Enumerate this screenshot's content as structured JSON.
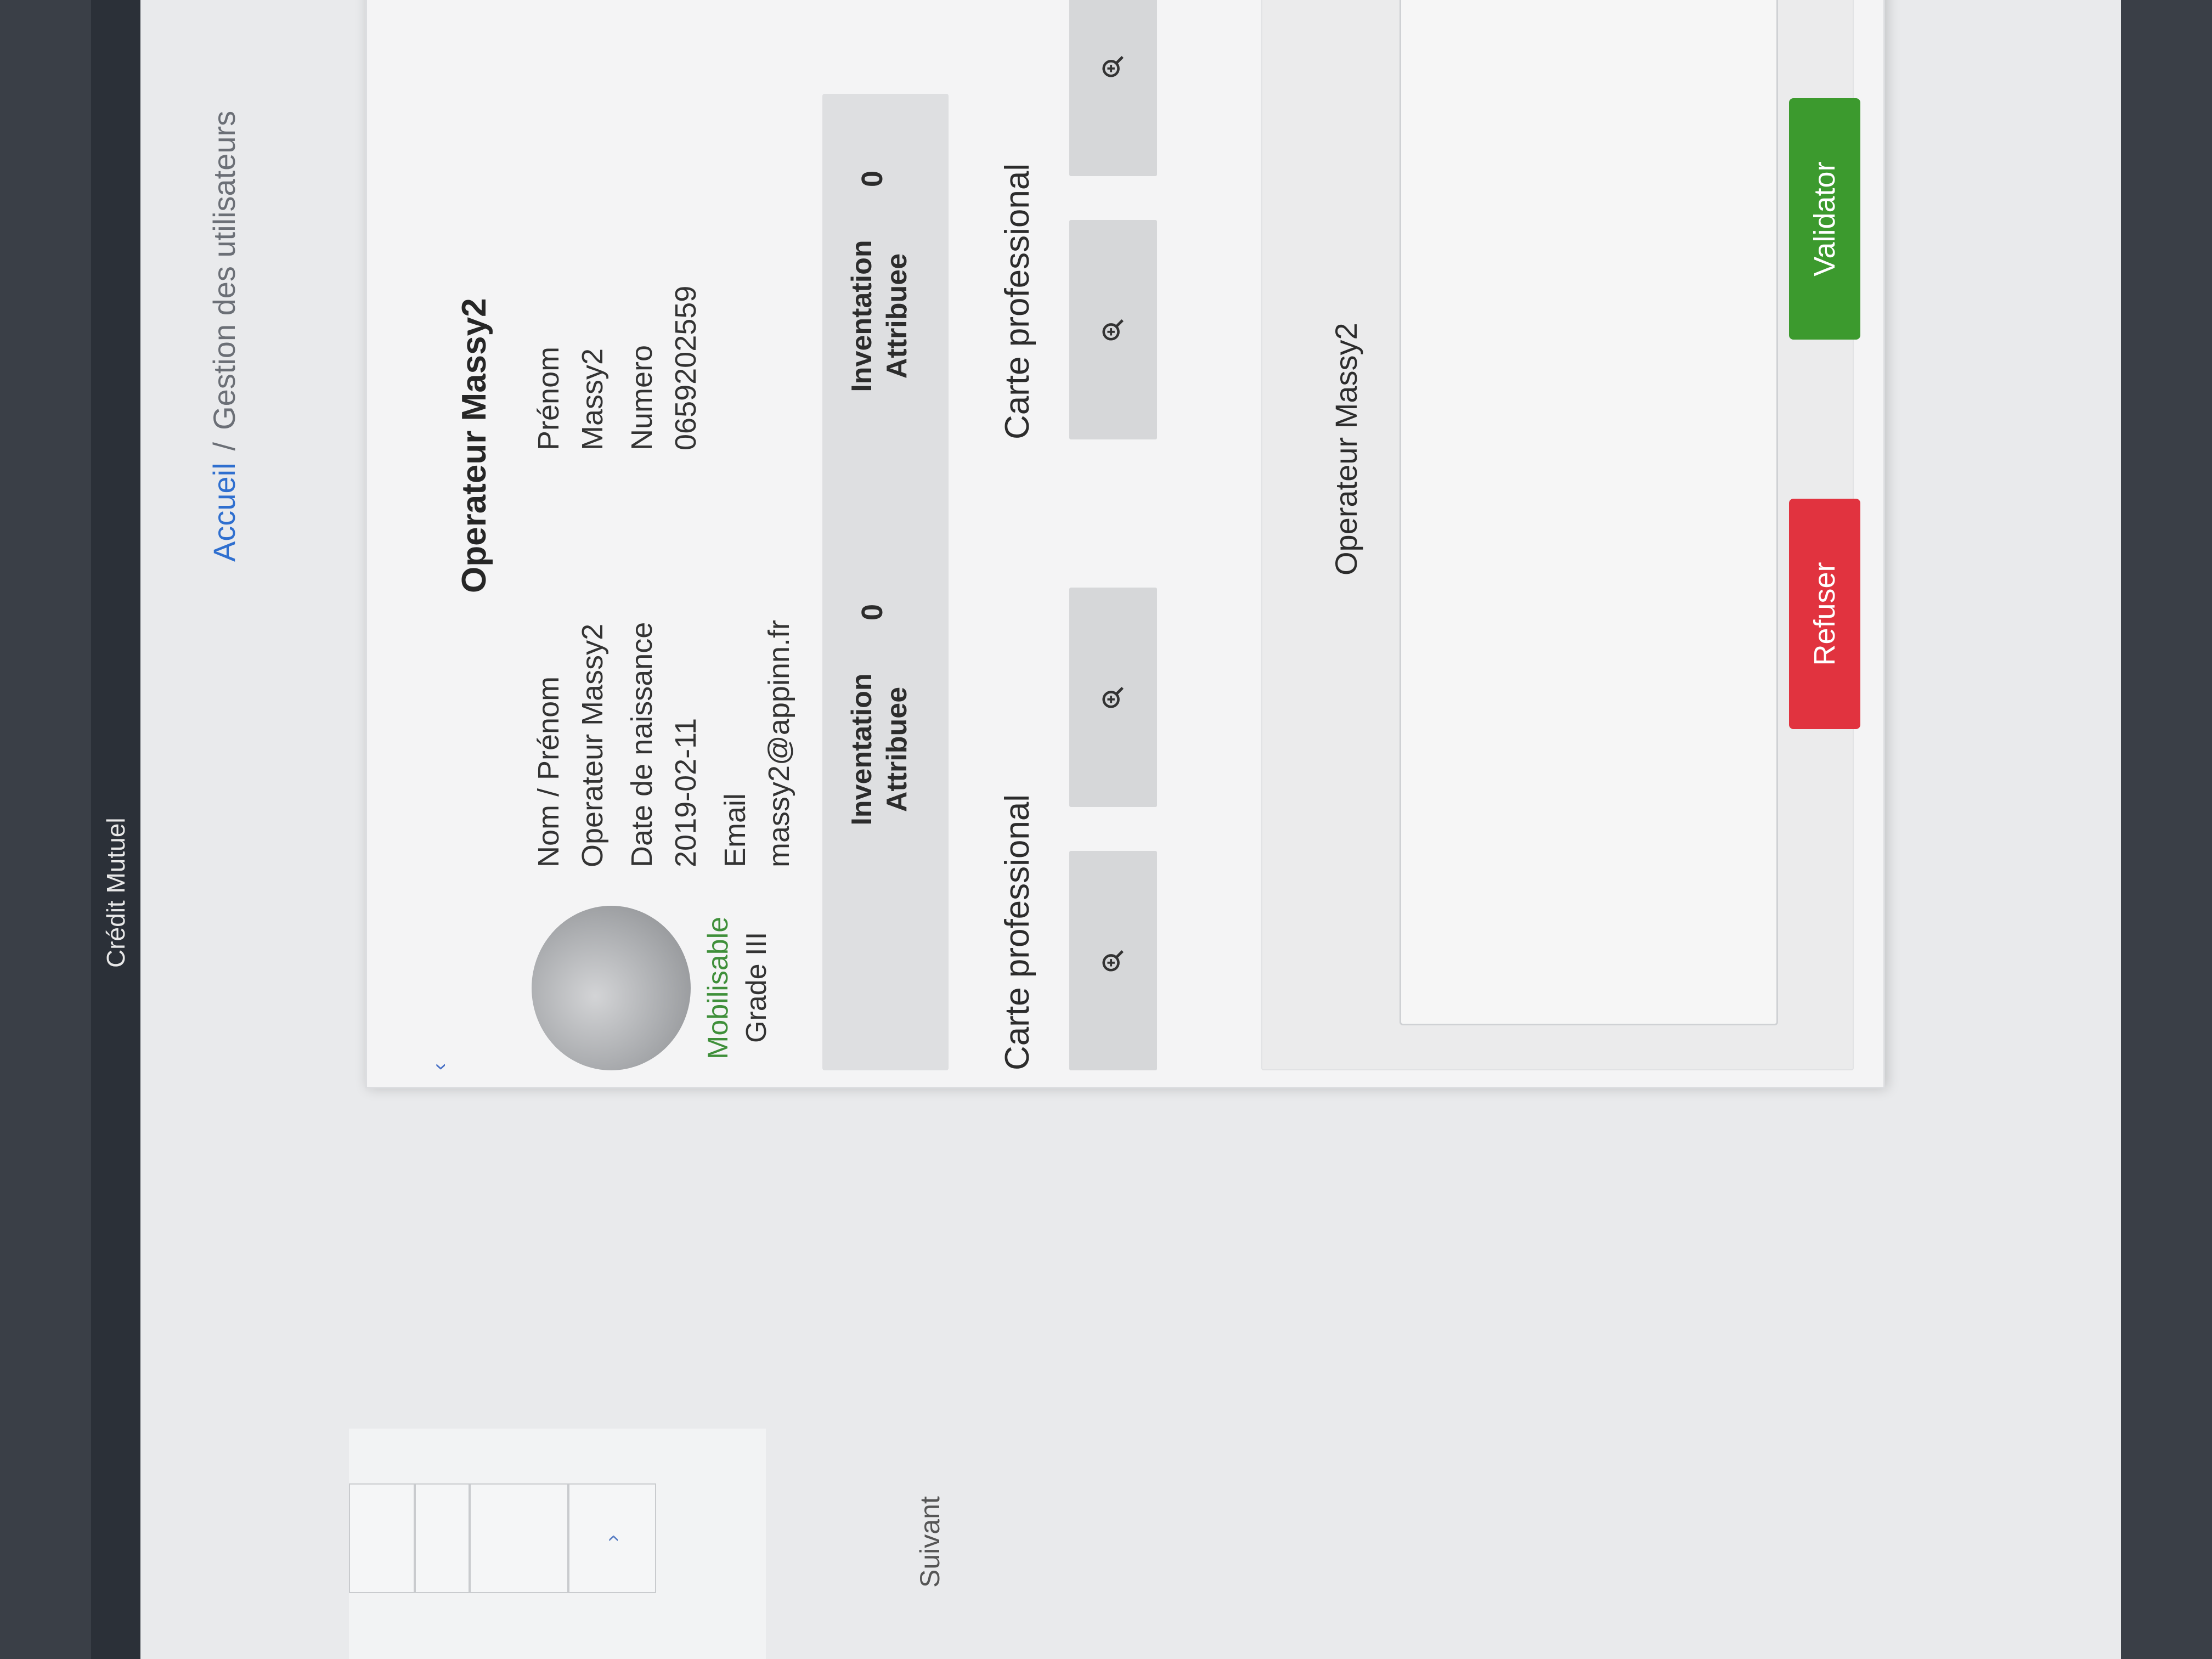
{
  "header": {
    "title": "Crédit Mutuel"
  },
  "breadcrumb": {
    "home": "Accueil",
    "separator": "/",
    "current": "Gestion des utilisateurs"
  },
  "pager": {
    "next_label": "Suivant",
    "next_symbol": "›"
  },
  "modal": {
    "title": "Operateur Massy2",
    "collapse_symbol": "‹",
    "profile": {
      "status": "Mobilisable",
      "grade": "Grade III",
      "fields": {
        "name_label": "Nom / Prénom",
        "name_value": "Operateur Massy2",
        "firstname_label": "Prénom",
        "firstname_value": "Massy2",
        "birthdate_label": "Date de naissance",
        "birthdate_value": "2019-02-11",
        "phone_label": "Numero",
        "phone_value": "0659202559",
        "email_label": "Email",
        "email_value": "massy2@appinn.fr"
      }
    },
    "stats": [
      {
        "label_line1": "Inventation",
        "label_line2": "Attribuee",
        "value": "0"
      },
      {
        "label_line1": "Inventation",
        "label_line2": "Attribuee",
        "value": "0"
      }
    ],
    "cards": [
      {
        "title": "Carte professional"
      },
      {
        "title": "Carte professional"
      }
    ],
    "comment_section": {
      "name": "Operateur Massy2",
      "textarea_value": ""
    },
    "actions": {
      "refuse_label": "Refuser",
      "validate_label": "Validator"
    }
  },
  "colors": {
    "refuse": "#e1333f",
    "validate": "#3c9a2e",
    "status_green": "#3f8f3a",
    "link_blue": "#2f6fcf"
  },
  "icons": [
    "zoom-in-icon",
    "chevron-left-icon",
    "chevron-right-icon"
  ]
}
